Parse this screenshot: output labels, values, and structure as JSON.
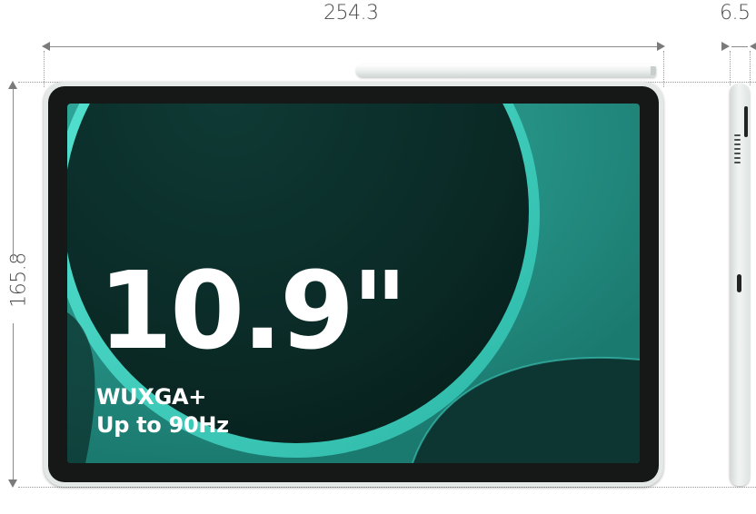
{
  "dimensions": {
    "width": "254.3",
    "height": "165.8",
    "depth": "6.5"
  },
  "screen": {
    "size": "10.9\"",
    "resolution": "WUXGA+",
    "refresh_rate": "Up to 90Hz"
  },
  "colors": {
    "screen_teal": "#47d6c4",
    "screen_dark": "#0a2a26",
    "frame": "#e4e9e7",
    "bezel": "#151817"
  }
}
